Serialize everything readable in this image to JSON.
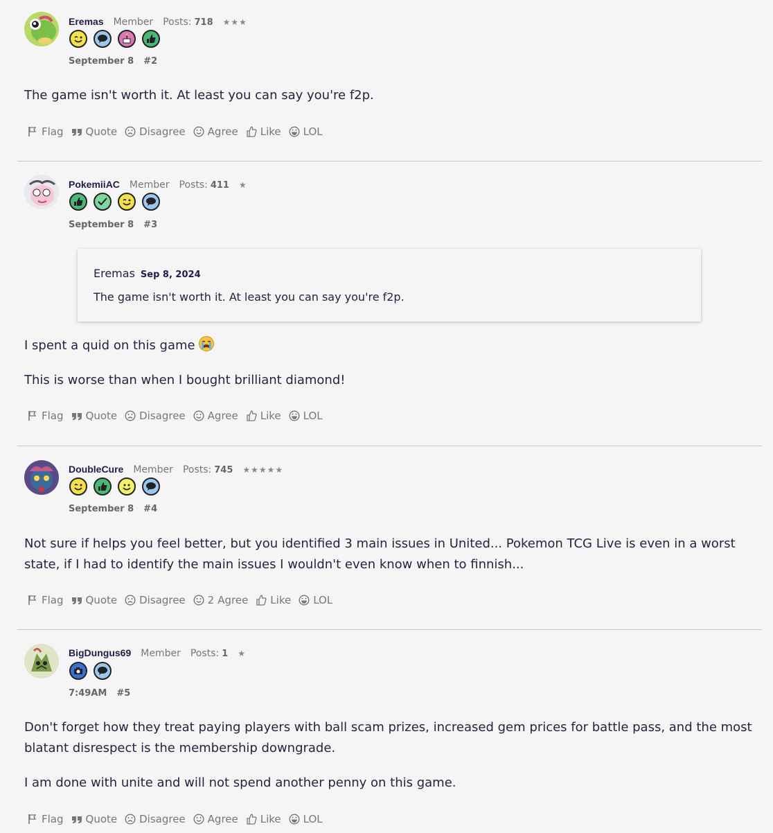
{
  "actions": {
    "flag": "Flag",
    "quote": "Quote",
    "disagree": "Disagree",
    "agree": "Agree",
    "like": "Like",
    "lol": "LOL"
  },
  "posts": [
    {
      "username": "Eremas",
      "role": "Member",
      "posts_label": "Posts:",
      "posts_count": "718",
      "stars": "★★★",
      "badges": [
        "wink-badge-icon",
        "comment-badge-icon",
        "cake-badge-icon",
        "thumbs-up-badge-icon"
      ],
      "date": "September 8",
      "number": "#2",
      "paragraphs": [
        "The game isn't worth it. At least you can say you're f2p."
      ],
      "agree_count": ""
    },
    {
      "username": "PokemiiAC",
      "role": "Member",
      "posts_label": "Posts:",
      "posts_count": "411",
      "stars": "★",
      "badges": [
        "thumbs-up-badge-icon",
        "checkmark-badge-icon",
        "wink-badge-icon",
        "comment-badge-icon"
      ],
      "date": "September 8",
      "number": "#3",
      "quote": {
        "author": "Eremas",
        "date": "Sep 8, 2024",
        "text": "The game isn't worth it. At least you can say you're f2p."
      },
      "paragraphs": [
        "I spent a quid on this game",
        "This is worse than when I bought brilliant diamond!"
      ],
      "emoji": "crying-face-emoji",
      "agree_count": ""
    },
    {
      "username": "DoubleCure",
      "role": "Member",
      "posts_label": "Posts:",
      "posts_count": "745",
      "stars": "★★★★★",
      "badges": [
        "wink-badge-icon",
        "thumbs-up-badge-icon",
        "smile-badge-icon",
        "comment-badge-icon"
      ],
      "date": "September 8",
      "number": "#4",
      "paragraphs": [
        "Not sure if helps you feel better, but you identified 3 main issues in United... Pokemon TCG Live is even in a worst state, if I had to identify the main issues I wouldn't even know when to finnish..."
      ],
      "agree_count": "2"
    },
    {
      "username": "BigDungus69",
      "role": "Member",
      "posts_label": "Posts:",
      "posts_count": "1",
      "stars": "★",
      "badges": [
        "camera-badge-icon",
        "comment-badge-icon"
      ],
      "date": "7:49AM",
      "number": "#5",
      "paragraphs": [
        "Don't forget how they treat paying players with ball scam prizes, increased gem prices for battle pass, and the most blatant disrespect is the membership downgrade.",
        "I am done with unite and will not spend another penny on this game."
      ],
      "agree_count": ""
    }
  ],
  "colors": {
    "badge_yellow": "#f4e04d",
    "badge_blue": "#9cc8f0",
    "badge_pink": "#d77ab4",
    "badge_green": "#4cb878",
    "badge_mint": "#7fd69e",
    "badge_camera": "#3b6fd1"
  }
}
